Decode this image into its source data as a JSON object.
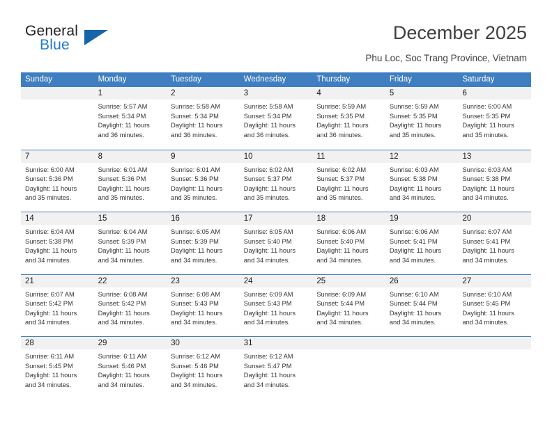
{
  "logo": {
    "word_one": "General",
    "word_two": "Blue",
    "accent_color": "#1565a8",
    "blue_text_color": "#1f7ac4"
  },
  "header": {
    "title": "December 2025",
    "subtitle": "Phu Loc, Soc Trang Province, Vietnam",
    "header_bar_color": "#3f7fc1"
  },
  "calendar": {
    "weekdays": [
      "Sunday",
      "Monday",
      "Tuesday",
      "Wednesday",
      "Thursday",
      "Friday",
      "Saturday"
    ],
    "weeks": [
      [
        {
          "day": "",
          "sunrise": "",
          "sunset": "",
          "daylight_line1": "",
          "daylight_line2": ""
        },
        {
          "day": "1",
          "sunrise": "Sunrise: 5:57 AM",
          "sunset": "Sunset: 5:34 PM",
          "daylight_line1": "Daylight: 11 hours",
          "daylight_line2": "and 36 minutes."
        },
        {
          "day": "2",
          "sunrise": "Sunrise: 5:58 AM",
          "sunset": "Sunset: 5:34 PM",
          "daylight_line1": "Daylight: 11 hours",
          "daylight_line2": "and 36 minutes."
        },
        {
          "day": "3",
          "sunrise": "Sunrise: 5:58 AM",
          "sunset": "Sunset: 5:34 PM",
          "daylight_line1": "Daylight: 11 hours",
          "daylight_line2": "and 36 minutes."
        },
        {
          "day": "4",
          "sunrise": "Sunrise: 5:59 AM",
          "sunset": "Sunset: 5:35 PM",
          "daylight_line1": "Daylight: 11 hours",
          "daylight_line2": "and 36 minutes."
        },
        {
          "day": "5",
          "sunrise": "Sunrise: 5:59 AM",
          "sunset": "Sunset: 5:35 PM",
          "daylight_line1": "Daylight: 11 hours",
          "daylight_line2": "and 35 minutes."
        },
        {
          "day": "6",
          "sunrise": "Sunrise: 6:00 AM",
          "sunset": "Sunset: 5:35 PM",
          "daylight_line1": "Daylight: 11 hours",
          "daylight_line2": "and 35 minutes."
        }
      ],
      [
        {
          "day": "7",
          "sunrise": "Sunrise: 6:00 AM",
          "sunset": "Sunset: 5:36 PM",
          "daylight_line1": "Daylight: 11 hours",
          "daylight_line2": "and 35 minutes."
        },
        {
          "day": "8",
          "sunrise": "Sunrise: 6:01 AM",
          "sunset": "Sunset: 5:36 PM",
          "daylight_line1": "Daylight: 11 hours",
          "daylight_line2": "and 35 minutes."
        },
        {
          "day": "9",
          "sunrise": "Sunrise: 6:01 AM",
          "sunset": "Sunset: 5:36 PM",
          "daylight_line1": "Daylight: 11 hours",
          "daylight_line2": "and 35 minutes."
        },
        {
          "day": "10",
          "sunrise": "Sunrise: 6:02 AM",
          "sunset": "Sunset: 5:37 PM",
          "daylight_line1": "Daylight: 11 hours",
          "daylight_line2": "and 35 minutes."
        },
        {
          "day": "11",
          "sunrise": "Sunrise: 6:02 AM",
          "sunset": "Sunset: 5:37 PM",
          "daylight_line1": "Daylight: 11 hours",
          "daylight_line2": "and 35 minutes."
        },
        {
          "day": "12",
          "sunrise": "Sunrise: 6:03 AM",
          "sunset": "Sunset: 5:38 PM",
          "daylight_line1": "Daylight: 11 hours",
          "daylight_line2": "and 34 minutes."
        },
        {
          "day": "13",
          "sunrise": "Sunrise: 6:03 AM",
          "sunset": "Sunset: 5:38 PM",
          "daylight_line1": "Daylight: 11 hours",
          "daylight_line2": "and 34 minutes."
        }
      ],
      [
        {
          "day": "14",
          "sunrise": "Sunrise: 6:04 AM",
          "sunset": "Sunset: 5:38 PM",
          "daylight_line1": "Daylight: 11 hours",
          "daylight_line2": "and 34 minutes."
        },
        {
          "day": "15",
          "sunrise": "Sunrise: 6:04 AM",
          "sunset": "Sunset: 5:39 PM",
          "daylight_line1": "Daylight: 11 hours",
          "daylight_line2": "and 34 minutes."
        },
        {
          "day": "16",
          "sunrise": "Sunrise: 6:05 AM",
          "sunset": "Sunset: 5:39 PM",
          "daylight_line1": "Daylight: 11 hours",
          "daylight_line2": "and 34 minutes."
        },
        {
          "day": "17",
          "sunrise": "Sunrise: 6:05 AM",
          "sunset": "Sunset: 5:40 PM",
          "daylight_line1": "Daylight: 11 hours",
          "daylight_line2": "and 34 minutes."
        },
        {
          "day": "18",
          "sunrise": "Sunrise: 6:06 AM",
          "sunset": "Sunset: 5:40 PM",
          "daylight_line1": "Daylight: 11 hours",
          "daylight_line2": "and 34 minutes."
        },
        {
          "day": "19",
          "sunrise": "Sunrise: 6:06 AM",
          "sunset": "Sunset: 5:41 PM",
          "daylight_line1": "Daylight: 11 hours",
          "daylight_line2": "and 34 minutes."
        },
        {
          "day": "20",
          "sunrise": "Sunrise: 6:07 AM",
          "sunset": "Sunset: 5:41 PM",
          "daylight_line1": "Daylight: 11 hours",
          "daylight_line2": "and 34 minutes."
        }
      ],
      [
        {
          "day": "21",
          "sunrise": "Sunrise: 6:07 AM",
          "sunset": "Sunset: 5:42 PM",
          "daylight_line1": "Daylight: 11 hours",
          "daylight_line2": "and 34 minutes."
        },
        {
          "day": "22",
          "sunrise": "Sunrise: 6:08 AM",
          "sunset": "Sunset: 5:42 PM",
          "daylight_line1": "Daylight: 11 hours",
          "daylight_line2": "and 34 minutes."
        },
        {
          "day": "23",
          "sunrise": "Sunrise: 6:08 AM",
          "sunset": "Sunset: 5:43 PM",
          "daylight_line1": "Daylight: 11 hours",
          "daylight_line2": "and 34 minutes."
        },
        {
          "day": "24",
          "sunrise": "Sunrise: 6:09 AM",
          "sunset": "Sunset: 5:43 PM",
          "daylight_line1": "Daylight: 11 hours",
          "daylight_line2": "and 34 minutes."
        },
        {
          "day": "25",
          "sunrise": "Sunrise: 6:09 AM",
          "sunset": "Sunset: 5:44 PM",
          "daylight_line1": "Daylight: 11 hours",
          "daylight_line2": "and 34 minutes."
        },
        {
          "day": "26",
          "sunrise": "Sunrise: 6:10 AM",
          "sunset": "Sunset: 5:44 PM",
          "daylight_line1": "Daylight: 11 hours",
          "daylight_line2": "and 34 minutes."
        },
        {
          "day": "27",
          "sunrise": "Sunrise: 6:10 AM",
          "sunset": "Sunset: 5:45 PM",
          "daylight_line1": "Daylight: 11 hours",
          "daylight_line2": "and 34 minutes."
        }
      ],
      [
        {
          "day": "28",
          "sunrise": "Sunrise: 6:11 AM",
          "sunset": "Sunset: 5:45 PM",
          "daylight_line1": "Daylight: 11 hours",
          "daylight_line2": "and 34 minutes."
        },
        {
          "day": "29",
          "sunrise": "Sunrise: 6:11 AM",
          "sunset": "Sunset: 5:46 PM",
          "daylight_line1": "Daylight: 11 hours",
          "daylight_line2": "and 34 minutes."
        },
        {
          "day": "30",
          "sunrise": "Sunrise: 6:12 AM",
          "sunset": "Sunset: 5:46 PM",
          "daylight_line1": "Daylight: 11 hours",
          "daylight_line2": "and 34 minutes."
        },
        {
          "day": "31",
          "sunrise": "Sunrise: 6:12 AM",
          "sunset": "Sunset: 5:47 PM",
          "daylight_line1": "Daylight: 11 hours",
          "daylight_line2": "and 34 minutes."
        },
        {
          "day": "",
          "sunrise": "",
          "sunset": "",
          "daylight_line1": "",
          "daylight_line2": ""
        },
        {
          "day": "",
          "sunrise": "",
          "sunset": "",
          "daylight_line1": "",
          "daylight_line2": ""
        },
        {
          "day": "",
          "sunrise": "",
          "sunset": "",
          "daylight_line1": "",
          "daylight_line2": ""
        }
      ]
    ]
  }
}
